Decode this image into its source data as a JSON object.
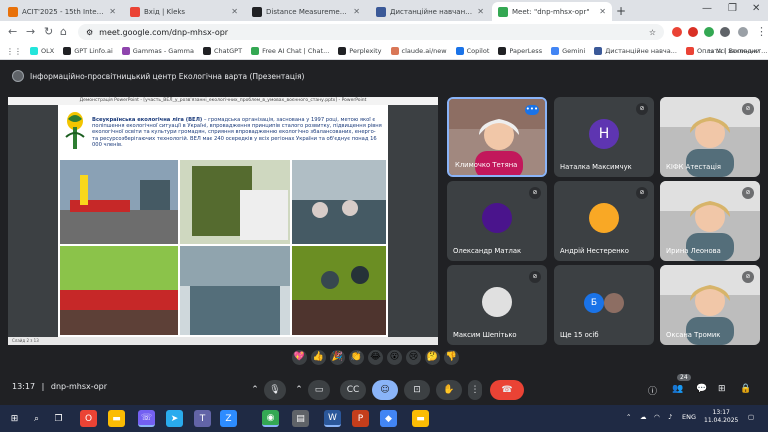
{
  "browser": {
    "tabs": [
      {
        "title": "АСІТ'2025 - 15th International Sc",
        "color": "#e8710a",
        "active": false
      },
      {
        "title": "Вхід | Kleks",
        "color": "#ea4335",
        "active": false
      },
      {
        "title": "Distance Measurement using A",
        "color": "#202124",
        "active": false
      },
      {
        "title": "Дистанційне навчання в ВСП",
        "color": "#3b5998",
        "active": false
      },
      {
        "title": "Meet: \"dnp-mhsx-opr\"",
        "color": "#34a853",
        "active": true
      }
    ],
    "new_tab": "+",
    "url": "meet.google.com/dnp-mhsx-opr",
    "bookmarks": [
      {
        "label": "OLX",
        "color": "#23e5db"
      },
      {
        "label": "GPT Linfo.ai",
        "color": "#202124"
      },
      {
        "label": "Gammas - Gamma",
        "color": "#8e44ad"
      },
      {
        "label": "ChatGPT",
        "color": "#202124"
      },
      {
        "label": "Free AI Chat | Chat...",
        "color": "#34a853"
      },
      {
        "label": "Perplexity",
        "color": "#202124"
      },
      {
        "label": "claude.ai/new",
        "color": "#d97757"
      },
      {
        "label": "Copilot",
        "color": "#1a73e8"
      },
      {
        "label": "PaperLess",
        "color": "#202124"
      },
      {
        "label": "Gemini",
        "color": "#4285f4"
      },
      {
        "label": "Дистанційне навча...",
        "color": "#3b5998"
      },
      {
        "label": "Оплата | Волинькт...",
        "color": "#ea4335"
      }
    ],
    "all_bookmarks": "Усі закладки"
  },
  "meet": {
    "title": "Інформаційно-просвітницький центр Екологічна варта (Презентація)",
    "ppt_title": "Демонстрація PowerPoint - [участь_ВЕЛ_у_розв'язанні_екологічних_проблем_в_умовах_воєнного_стану.pptx] - PowerPoint",
    "ppt_status": "Слайд 2 з 13",
    "slide": {
      "heading": "Всеукраїнська екологічна ліга (ВЕЛ)",
      "body": " – громадська організація, заснована у 1997 році, метою якої є поліпшення екологічної ситуації в Україні, впровадження принципів сталого розвитку, підвищення рівня екологічної освіти та культури громадян, сприяння впровадженню екологічно збалансованих, енерго- та ресурсозберігаючих технологій. ВЕЛ має 240 осередків у всіх регіонах України та об'єднує понад 16 000 членів."
    },
    "participants": [
      {
        "name": "Климочко Тетяна",
        "type": "video",
        "speaking": true
      },
      {
        "name": "Наталка Максимчук",
        "type": "avatar",
        "initial": "Н",
        "color": "#5e35b1"
      },
      {
        "name": "КІФК Атестація",
        "type": "video"
      },
      {
        "name": "Олександр Матлак",
        "type": "photo",
        "color": "#4a148c"
      },
      {
        "name": "Андрій Нестеренко",
        "type": "photo",
        "color": "#f9a825"
      },
      {
        "name": "Ирина Леонова",
        "type": "video"
      },
      {
        "name": "Максим Шепітько",
        "type": "photo",
        "color": "#e0e0e0"
      },
      {
        "name": "Ще 15 осіб",
        "type": "group",
        "initial": "Б",
        "color": "#1a73e8"
      },
      {
        "name": "Оксана Тромик",
        "type": "video"
      }
    ],
    "reactions": [
      "💖",
      "👍",
      "🎉",
      "👏",
      "😂",
      "😮",
      "😢",
      "🤔",
      "👎"
    ],
    "time": "13:17",
    "separator": "|",
    "meeting_code": "dnp-mhsx-opr",
    "people_count": "24"
  },
  "taskbar": {
    "lang": "ENG",
    "time": "13:17",
    "date": "11.04.2025"
  }
}
